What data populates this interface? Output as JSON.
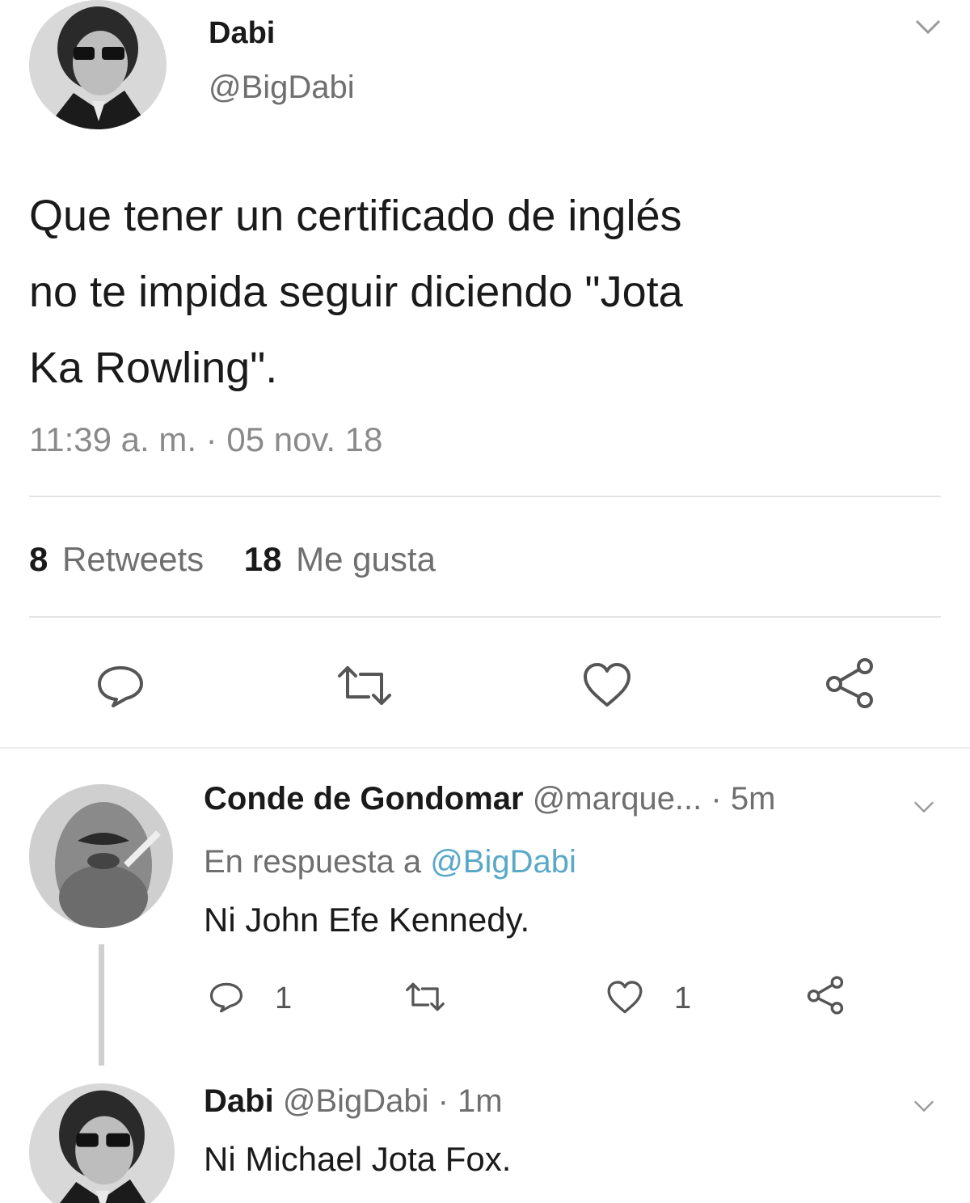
{
  "main_tweet": {
    "display_name": "Dabi",
    "handle": "@BigDabi",
    "text_lines": [
      "Que tener un certificado de inglés",
      "no te impida seguir diciendo \"Jota",
      "Ka Rowling\"."
    ],
    "timestamp": "11:39 a. m. · 05 nov. 18",
    "retweets_count": "8",
    "retweets_label": "Retweets",
    "likes_count": "18",
    "likes_label": "Me gusta",
    "actions": [
      "reply-icon",
      "retweet-icon",
      "like-icon",
      "share-icon"
    ]
  },
  "reply_1": {
    "display_name": "Conde de Gondomar",
    "handle": "@marque...",
    "time": "· 5m",
    "in_reply_prefix": "En respuesta a",
    "in_reply_handle": "@BigDabi",
    "text": "Ni John Efe Kennedy.",
    "reply_count": "1",
    "like_count": "1"
  },
  "reply_2": {
    "display_name": "Dabi",
    "handle": "@BigDabi",
    "time": "· 1m",
    "text": "Ni Michael Jota Fox."
  },
  "colors": {
    "link_blue": "#5aa8c8",
    "text": "#1a1a1a",
    "muted": "#6f6f6f",
    "divider": "#e4e4e4"
  }
}
